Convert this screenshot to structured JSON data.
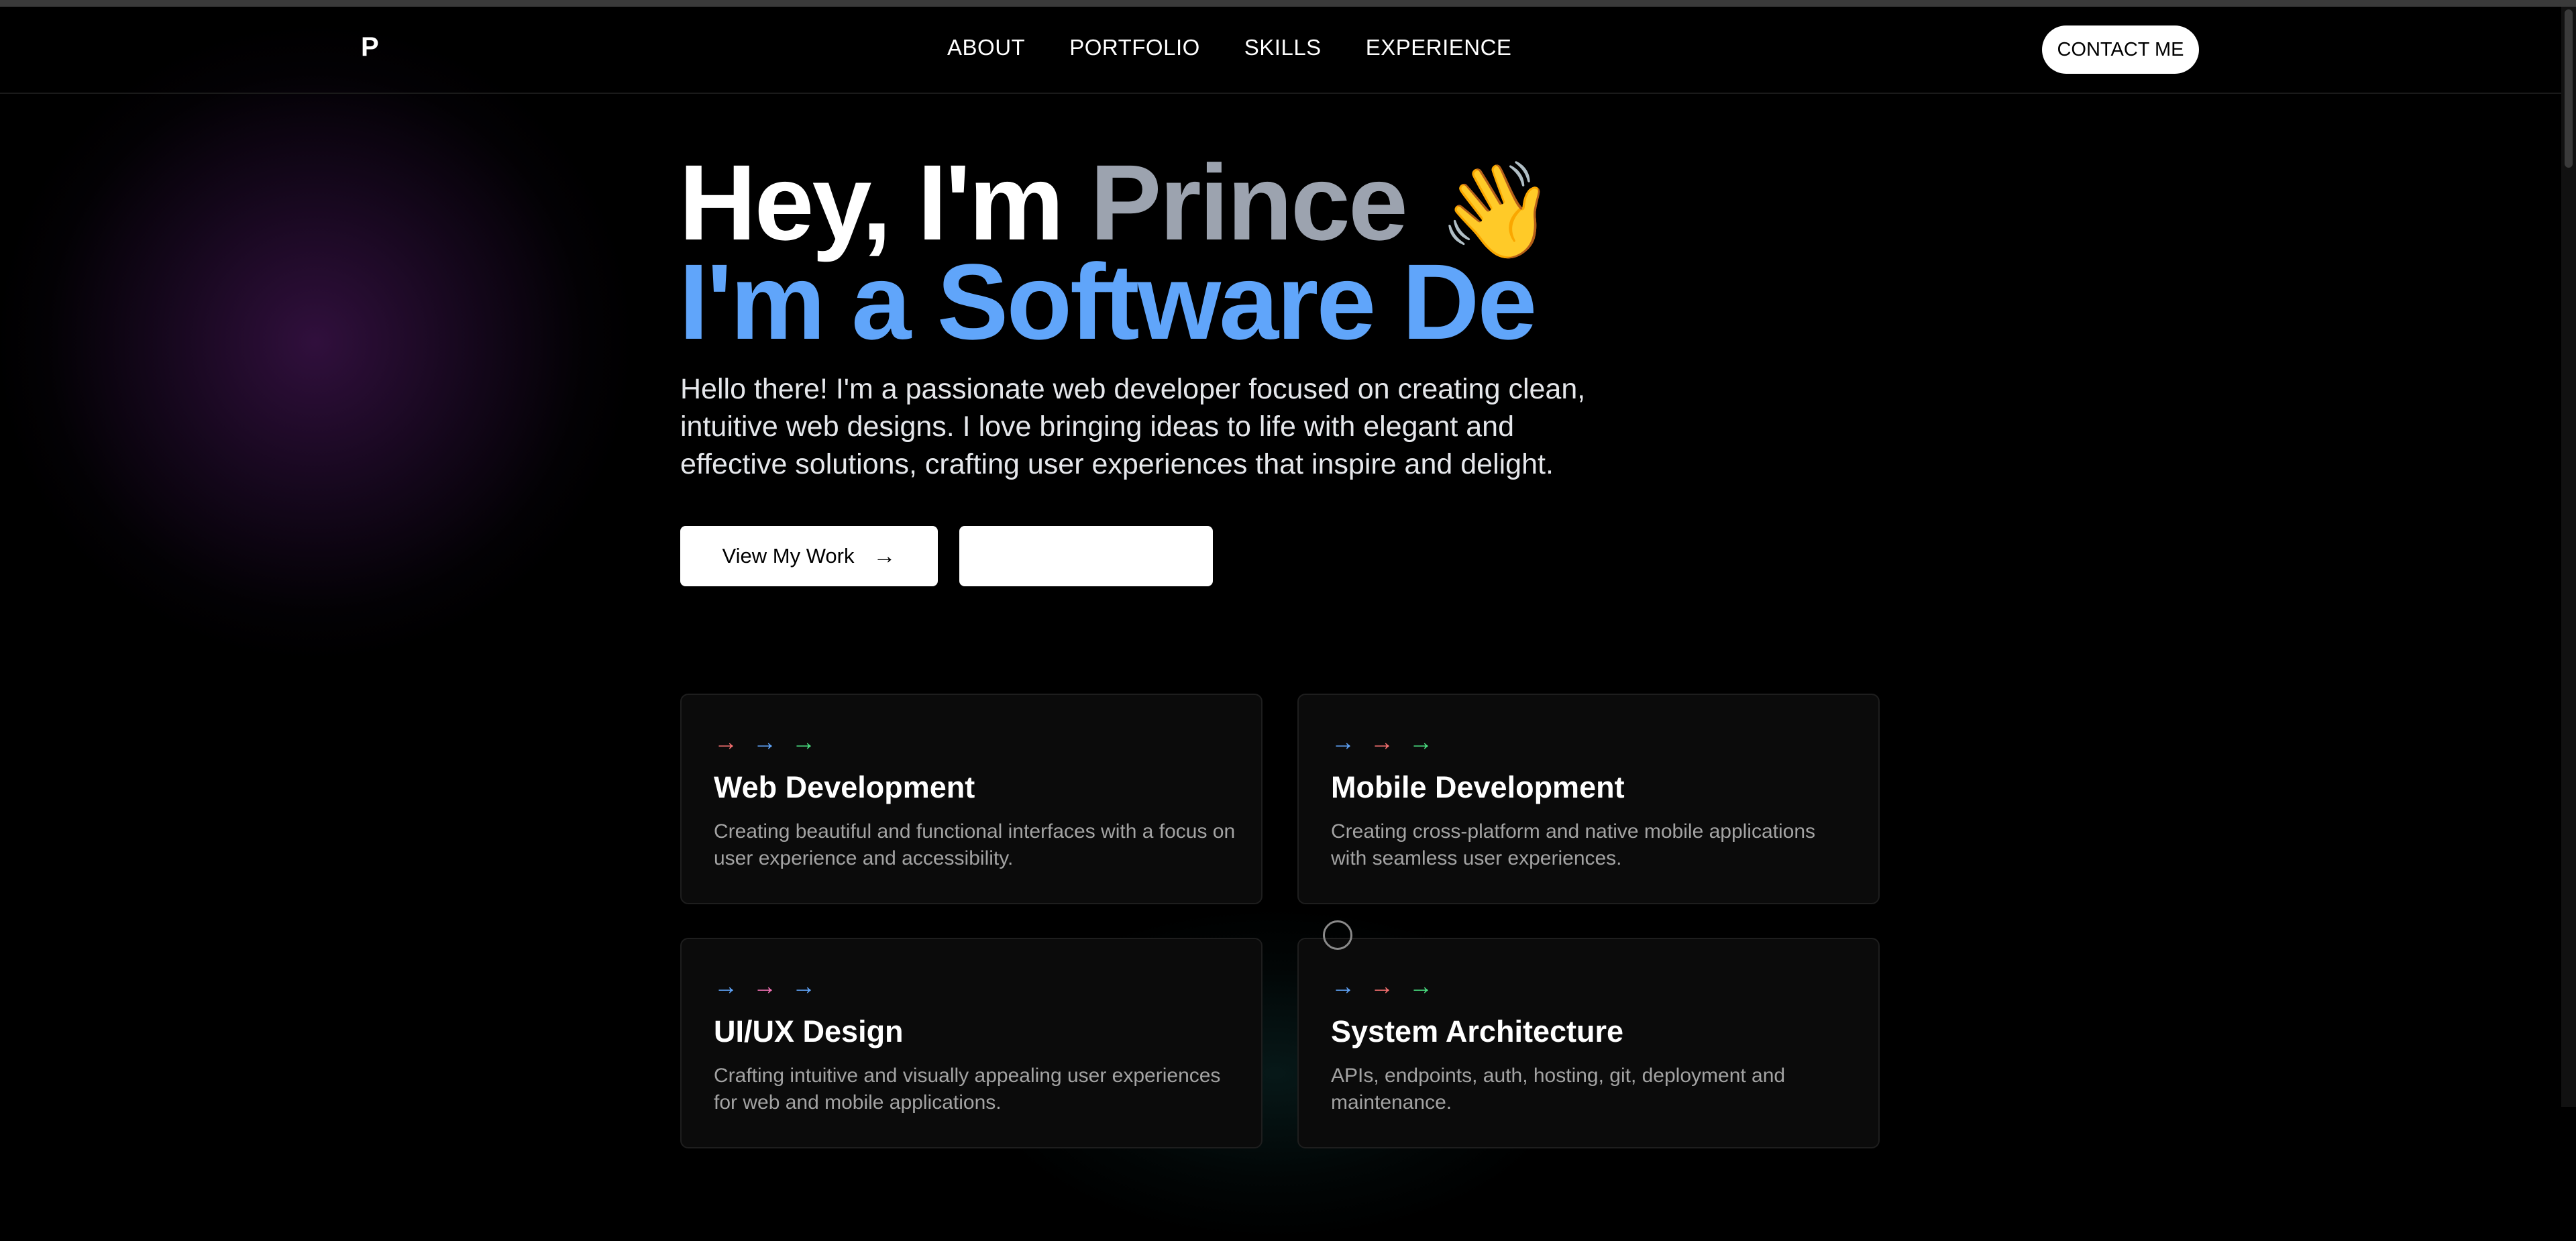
{
  "nav": {
    "logo": "P",
    "links": [
      "ABOUT",
      "PORTFOLIO",
      "SKILLS",
      "EXPERIENCE"
    ],
    "contact_label": "CONTACT ME"
  },
  "hero": {
    "greeting": "Hey, I'm ",
    "name": "Prince",
    "wave_emoji": "👋",
    "typed_line": "I'm a Software De",
    "description": "Hello there! I'm a passionate web developer focused on creating clean, intuitive web designs. I love bringing ideas to life with elegant and effective solutions, crafting user experiences that inspire and delight.",
    "primary_button": "View My Work",
    "primary_button_icon": "→"
  },
  "services": [
    {
      "title": "Web Development",
      "description": "Creating beautiful and functional interfaces with a focus on user experience and accessibility.",
      "arrow_colors": [
        "#f87171",
        "#60a5fa",
        "#4ade80"
      ]
    },
    {
      "title": "Mobile Development",
      "description": "Creating cross-platform and native mobile applications with seamless user experiences.",
      "arrow_colors": [
        "#60a5fa",
        "#f87171",
        "#4ade80"
      ]
    },
    {
      "title": "UI/UX Design",
      "description": "Crafting intuitive and visually appealing user experiences for web and mobile applications.",
      "arrow_colors": [
        "#60a5fa",
        "#f472b6",
        "#60a5fa"
      ]
    },
    {
      "title": "System Architecture",
      "description": "APIs, endpoints, auth, hosting, git, deployment and maintenance.",
      "arrow_colors": [
        "#60a5fa",
        "#f87171",
        "#4ade80"
      ]
    }
  ],
  "colors": {
    "background": "#000000",
    "accent_blue": "#60a5fa",
    "name_gray": "#9ca3af"
  }
}
